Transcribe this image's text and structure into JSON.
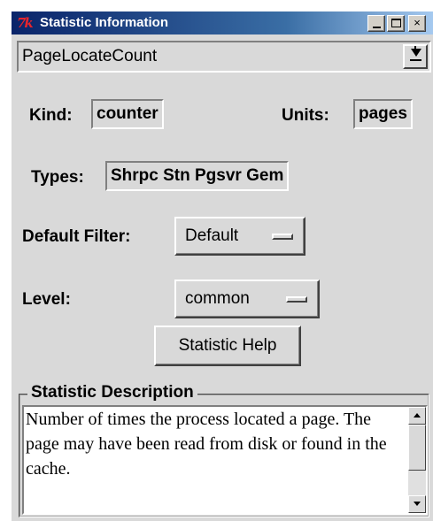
{
  "window": {
    "title": "Statistic Information",
    "icon_text": "7k",
    "controls": {
      "minimize": "_",
      "maximize": "□",
      "close": "×"
    }
  },
  "statistic_selector": {
    "value": "PageLocateCount"
  },
  "kind": {
    "label": "Kind:",
    "value": "counter"
  },
  "units": {
    "label": "Units:",
    "value": "pages"
  },
  "types": {
    "label": "Types:",
    "value": "Shrpc Stn Pgsvr Gem"
  },
  "default_filter": {
    "label": "Default Filter:",
    "value": "Default"
  },
  "level": {
    "label": "Level:",
    "value": "common"
  },
  "help_button": {
    "label": "Statistic Help"
  },
  "description": {
    "title": "Statistic Description",
    "text": "Number of times the process located a page.  The page may have been read from disk or found in the cache."
  },
  "colors": {
    "window_bg": "#d9d9d9",
    "titlebar_start": "#0a246a",
    "titlebar_end": "#a6caf0"
  }
}
